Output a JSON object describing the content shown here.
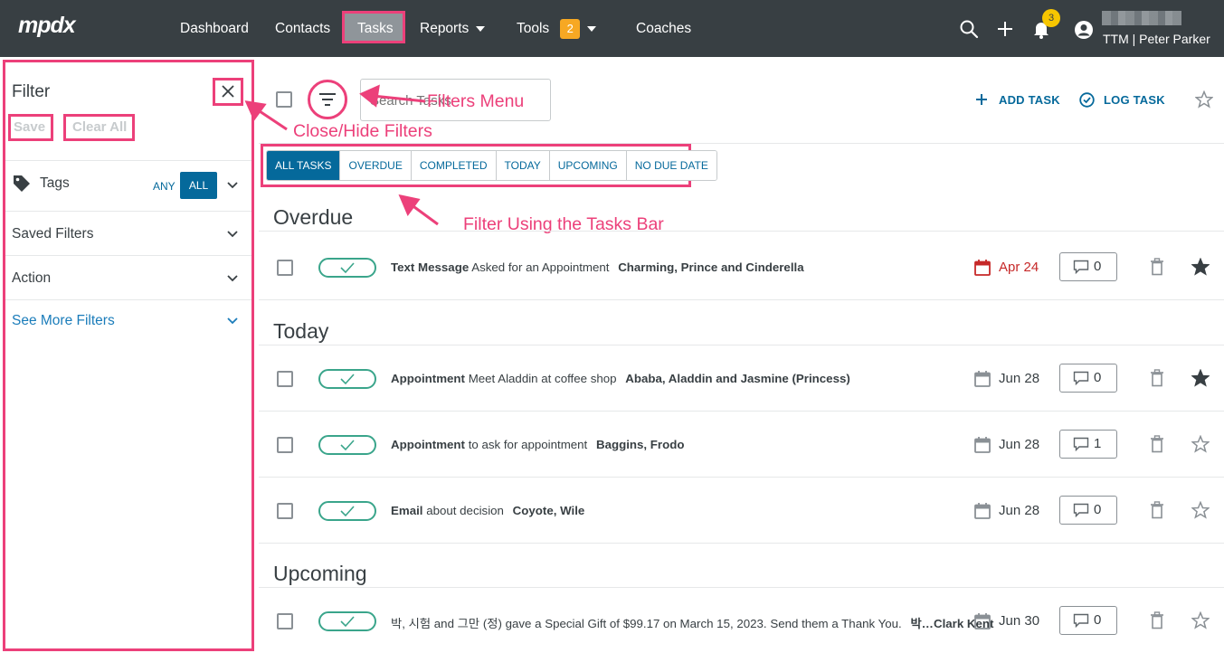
{
  "nav": {
    "logo": "mpdx",
    "items": [
      "Dashboard",
      "Contacts",
      "Tasks",
      "Reports",
      "Tools",
      "Coaches"
    ],
    "tools_badge": "2",
    "notifications_badge": "3",
    "user_name": "TTM | Peter Parker"
  },
  "filter": {
    "title": "Filter",
    "save_label": "Save",
    "clear_label": "Clear All",
    "tags_label": "Tags",
    "any_label": "ANY",
    "all_label": "ALL",
    "saved_filters_label": "Saved Filters",
    "action_label": "Action",
    "see_more_label": "See More Filters"
  },
  "header": {
    "search_placeholder": "Search Tasks",
    "add_task": "ADD TASK",
    "log_task": "LOG TASK"
  },
  "annotations": {
    "filters_menu": "Filters Menu",
    "close_hide": "Close/Hide Filters",
    "tasks_bar": "Filter Using the Tasks Bar"
  },
  "tabs": [
    "ALL TASKS",
    "OVERDUE",
    "COMPLETED",
    "TODAY",
    "UPCOMING",
    "NO DUE DATE"
  ],
  "sections": {
    "overdue": "Overdue",
    "today": "Today",
    "upcoming": "Upcoming"
  },
  "tasks": [
    {
      "kind": "Text Message",
      "subject": "Asked for an Appointment",
      "contacts": "Charming, Prince and Cinderella",
      "due": "Apr 24",
      "comments": "0",
      "starred": true,
      "late": true
    },
    {
      "kind": "Appointment",
      "subject": "Meet Aladdin at coffee shop",
      "contacts": "Ababa, Aladdin and Jasmine (Princess)",
      "due": "Jun 28",
      "comments": "0",
      "starred": true,
      "late": false
    },
    {
      "kind": "Appointment",
      "subject": "to ask for appointment",
      "contacts": "Baggins, Frodo",
      "due": "Jun 28",
      "comments": "1",
      "starred": false,
      "late": false
    },
    {
      "kind": "Email",
      "subject": "about decision",
      "contacts": "Coyote, Wile",
      "due": "Jun 28",
      "comments": "0",
      "starred": false,
      "late": false
    },
    {
      "kind": "",
      "subject": "박, 시험 and 그만 (정) gave a Special Gift of $99.17 on March 15, 2023. Send them a Thank You.",
      "contacts": "박…Clark Kent",
      "due": "Jun 30",
      "comments": "0",
      "starred": false,
      "late": false
    }
  ],
  "colors": {
    "nav_bg": "#383f43",
    "accent_blue": "#05699b",
    "highlight_pink": "#ec407a",
    "complete_green": "#3aa58b",
    "late_red": "#c62828"
  }
}
